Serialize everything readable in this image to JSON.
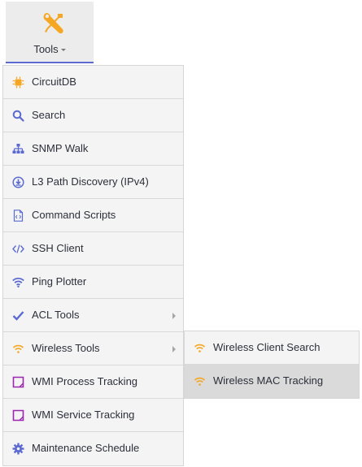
{
  "header": {
    "tools_label": "Tools",
    "tools_icon": "tools-icon"
  },
  "colors": {
    "accent": "#5a6ad0",
    "orange": "#f5a623",
    "purple": "#9c27b0",
    "hover_bg": "#dadada"
  },
  "menu": {
    "items": [
      {
        "label": "CircuitDB",
        "icon": "chip-icon"
      },
      {
        "label": "Search",
        "icon": "search-icon"
      },
      {
        "label": "SNMP Walk",
        "icon": "hierarchy-icon"
      },
      {
        "label": "L3 Path Discovery (IPv4)",
        "icon": "download-circle-icon"
      },
      {
        "label": "Command Scripts",
        "icon": "script-file-icon"
      },
      {
        "label": "SSH Client",
        "icon": "code-icon"
      },
      {
        "label": "Ping Plotter",
        "icon": "wifi-icon"
      },
      {
        "label": "ACL Tools",
        "icon": "check-icon",
        "has_submenu": true
      },
      {
        "label": "Wireless Tools",
        "icon": "wireless-icon",
        "has_submenu": true
      },
      {
        "label": "WMI Process Tracking",
        "icon": "wmi-process-icon"
      },
      {
        "label": "WMI Service Tracking",
        "icon": "wmi-service-icon"
      },
      {
        "label": "Maintenance Schedule",
        "icon": "gear-icon"
      }
    ]
  },
  "submenu": {
    "items": [
      {
        "label": "Wireless Client Search",
        "icon": "wireless-icon"
      },
      {
        "label": "Wireless MAC Tracking",
        "icon": "wireless-icon",
        "hover": true
      }
    ]
  }
}
